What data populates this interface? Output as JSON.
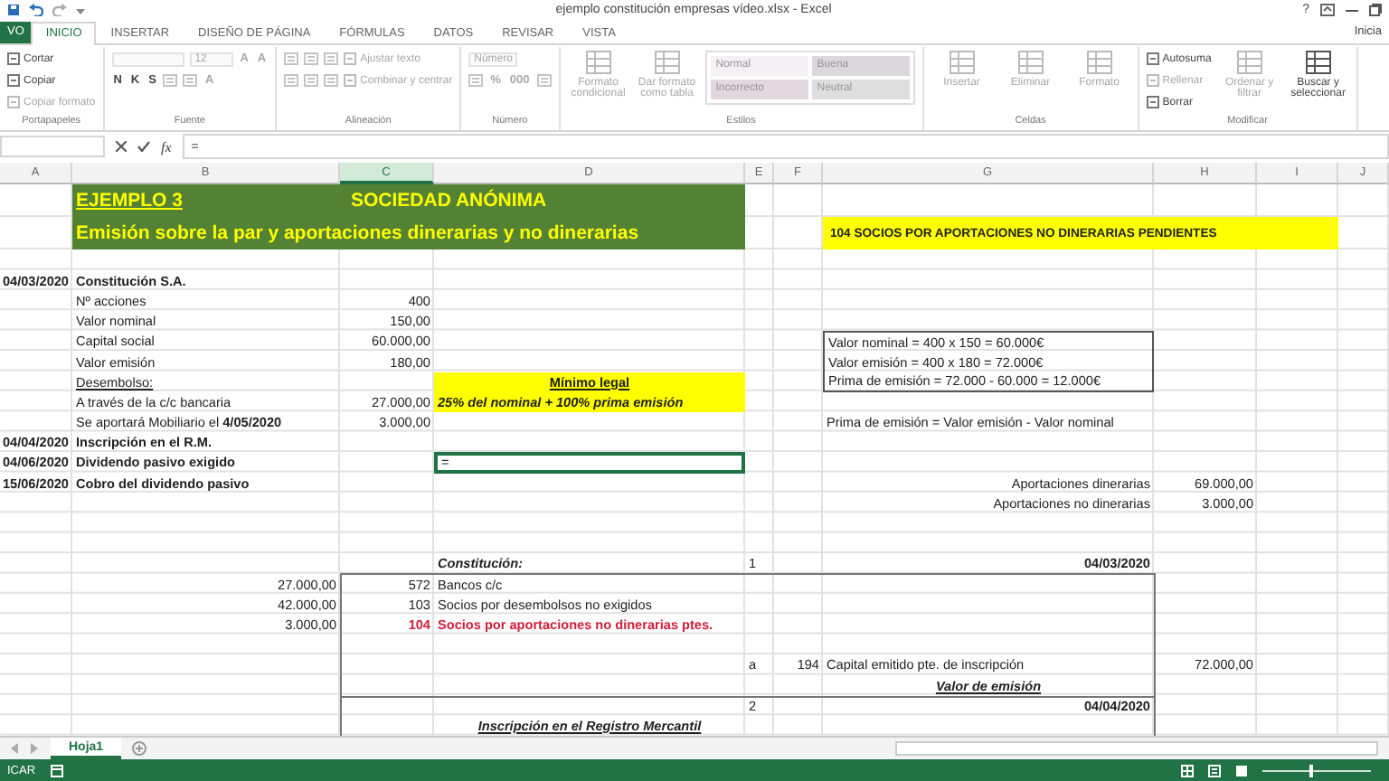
{
  "window": {
    "title": "ejemplo constitución empresas vídeo.xlsx - Excel",
    "help": "?",
    "account": "Inicia"
  },
  "tabs": [
    {
      "label": "VO",
      "kind": "file",
      "selected": false
    },
    {
      "label": "INICIO",
      "kind": "tab",
      "selected": true
    },
    {
      "label": "INSERTAR",
      "kind": "tab",
      "selected": false
    },
    {
      "label": "DISEÑO DE PÁGINA",
      "kind": "tab",
      "selected": false
    },
    {
      "label": "FÓRMULAS",
      "kind": "tab",
      "selected": false
    },
    {
      "label": "DATOS",
      "kind": "tab",
      "selected": false
    },
    {
      "label": "REVISAR",
      "kind": "tab",
      "selected": false
    },
    {
      "label": "VISTA",
      "kind": "tab",
      "selected": false
    }
  ],
  "ribbon": {
    "groups": [
      {
        "label": "Portapapeles",
        "items": [
          {
            "kind": "stack",
            "rows": [
              [
                {
                  "kind": "small",
                  "text": "Cortar",
                  "disabled": false
                }
              ],
              [
                {
                  "kind": "small",
                  "text": "Copiar",
                  "disabled": false
                }
              ],
              [
                {
                  "kind": "small",
                  "text": "Copiar formato",
                  "disabled": true
                }
              ]
            ]
          }
        ]
      },
      {
        "label": "Fuente",
        "items": [
          {
            "kind": "stack",
            "rows": [
              [
                {
                  "kind": "field",
                  "disabled": true
                },
                {
                  "kind": "field",
                  "value": "12",
                  "disabled": true
                },
                {
                  "kind": "glyph",
                  "text": "A",
                  "disabled": true
                },
                {
                  "kind": "glyph",
                  "text": "A",
                  "disabled": true
                }
              ],
              [
                {
                  "kind": "glyph",
                  "text": "N",
                  "disabled": false
                },
                {
                  "kind": "glyph",
                  "text": "K",
                  "disabled": false
                },
                {
                  "kind": "glyph",
                  "text": "S",
                  "disabled": false
                },
                {
                  "kind": "icon",
                  "disabled": true
                },
                {
                  "kind": "icon",
                  "disabled": true
                },
                {
                  "kind": "glyph",
                  "text": "A",
                  "disabled": true
                }
              ]
            ]
          }
        ]
      },
      {
        "label": "Alineación",
        "items": [
          {
            "kind": "stack",
            "rows": [
              [
                {
                  "kind": "icon",
                  "disabled": true
                },
                {
                  "kind": "icon",
                  "disabled": true
                },
                {
                  "kind": "icon",
                  "disabled": true
                },
                {
                  "kind": "small",
                  "text": "Ajustar texto",
                  "disabled": true
                }
              ],
              [
                {
                  "kind": "icon",
                  "disabled": true
                },
                {
                  "kind": "icon",
                  "disabled": true
                },
                {
                  "kind": "icon",
                  "disabled": true
                },
                {
                  "kind": "small",
                  "text": "Combinar y centrar",
                  "disabled": true
                }
              ]
            ]
          }
        ]
      },
      {
        "label": "Número",
        "items": [
          {
            "kind": "stack",
            "rows": [
              [
                {
                  "kind": "field",
                  "value": "Número",
                  "disabled": true
                }
              ],
              [
                {
                  "kind": "icon",
                  "disabled": true
                },
                {
                  "kind": "glyph",
                  "text": "%",
                  "disabled": true
                },
                {
                  "kind": "glyph",
                  "text": "000",
                  "disabled": true
                },
                {
                  "kind": "icon",
                  "disabled": true
                }
              ]
            ]
          }
        ]
      },
      {
        "label": "Estilos",
        "items": [
          {
            "kind": "big",
            "text": "Formato condicional",
            "disabled": true
          },
          {
            "kind": "big",
            "text": "Dar formato como tabla",
            "disabled": true
          },
          {
            "kind": "gallery",
            "cells": [
              {
                "text": "Normal",
                "color": "#f4f0f4"
              },
              {
                "text": "Buena",
                "color": "#dcd7dc"
              },
              {
                "text": "Incorrecto",
                "color": "#e2d7de"
              },
              {
                "text": "Neutral",
                "color": "#dedede"
              }
            ]
          }
        ]
      },
      {
        "label": "Celdas",
        "items": [
          {
            "kind": "big",
            "text": "Insertar",
            "disabled": true
          },
          {
            "kind": "big",
            "text": "Eliminar",
            "disabled": true
          },
          {
            "kind": "big",
            "text": "Formato",
            "disabled": true
          }
        ]
      },
      {
        "label": "Modificar",
        "items": [
          {
            "kind": "stack",
            "rows": [
              [
                {
                  "kind": "small",
                  "text": "Autosuma",
                  "disabled": false
                }
              ],
              [
                {
                  "kind": "small",
                  "text": "Rellenar",
                  "disabled": true
                }
              ],
              [
                {
                  "kind": "small",
                  "text": "Borrar",
                  "disabled": false
                }
              ]
            ]
          },
          {
            "kind": "big",
            "text": "Ordenar y filtrar",
            "disabled": true
          },
          {
            "kind": "big",
            "text": "Buscar y seleccionar",
            "disabled": false
          }
        ]
      }
    ]
  },
  "formula_bar": {
    "function_label": "fx",
    "content": "="
  },
  "sheet": {
    "columns": [
      {
        "label": "A",
        "selected": false
      },
      {
        "label": "B",
        "selected": false
      },
      {
        "label": "C",
        "selected": true
      },
      {
        "label": "D",
        "selected": false
      },
      {
        "label": "E",
        "selected": false
      },
      {
        "label": "F",
        "selected": false
      },
      {
        "label": "G",
        "selected": false
      },
      {
        "label": "H",
        "selected": false
      },
      {
        "label": "I",
        "selected": false
      },
      {
        "label": "J",
        "selected": false
      }
    ],
    "rows": [
      {
        "B": {
          "text": "EJEMPLO 3",
          "kind": "banner-label"
        },
        "C": {
          "text": "SOCIEDAD ANÓNIMA",
          "kind": "banner-title"
        }
      },
      {
        "B": {
          "text": "Emisión sobre la par y aportaciones dinerarias y no dinerarias",
          "kind": "banner-sub"
        },
        "G": {
          "text": "104 SOCIOS POR APORTACIONES NO DINERARIAS PENDIENTES",
          "kind": "note"
        }
      },
      {},
      {
        "A": {
          "text": "04/03/2020",
          "kind": "date"
        },
        "B": {
          "text": "Constitución S.A.",
          "kind": "heading"
        }
      },
      {
        "B": {
          "text": "Nº acciones",
          "kind": "text"
        },
        "C": {
          "text": "400",
          "kind": "number"
        }
      },
      {
        "B": {
          "text": "Valor nominal",
          "kind": "text"
        },
        "C": {
          "text": "150,00",
          "kind": "number"
        }
      },
      {
        "B": {
          "text": "Capital social",
          "kind": "text"
        },
        "C": {
          "text": "60.000,00",
          "kind": "number"
        },
        "G": {
          "text": "Valor nominal = 400 x 150 = 60.000€",
          "kind": "boxed"
        }
      },
      {
        "B": {
          "text": "Valor emisión",
          "kind": "text"
        },
        "C": {
          "text": "180,00",
          "kind": "number"
        },
        "G": {
          "text": "Valor emisión = 400 x 180 = 72.000€",
          "kind": "boxed"
        }
      },
      {
        "B": {
          "text": "Desembolso:",
          "kind": "underlined"
        },
        "D": {
          "text": "Mínimo legal",
          "kind": "legal-title"
        },
        "G": {
          "text": "Prima de emisión = 72.000 - 60.000 = 12.000€",
          "kind": "boxed"
        }
      },
      {
        "B": {
          "text": "A través  de la c/c bancaria",
          "kind": "text"
        },
        "C": {
          "text": "27.000,00",
          "kind": "number"
        },
        "D": {
          "text": "25% del nominal + 100% prima emisión",
          "kind": "legal-note"
        }
      },
      {
        "B": {
          "text": "Se aportará Mobiliario  el **4/05/2020**",
          "kind": "text"
        },
        "C": {
          "text": "3.000,00",
          "kind": "number"
        },
        "G": {
          "text": "Prima de emisión = Valor emisión - Valor nominal",
          "kind": "text"
        }
      },
      {
        "A": {
          "text": "04/04/2020",
          "kind": "date"
        },
        "B": {
          "text": "Inscripción en el R.M.",
          "kind": "heading"
        }
      },
      {
        "A": {
          "text": "04/06/2020",
          "kind": "date"
        },
        "B": {
          "text": "Dividendo pasivo exigido",
          "kind": "heading"
        },
        "D": {
          "text": "=",
          "kind": "active"
        }
      },
      {
        "A": {
          "text": "15/06/2020",
          "kind": "date"
        },
        "B": {
          "text": "Cobro del dividendo pasivo",
          "kind": "heading"
        },
        "G": {
          "text": "Aportaciones dinerarias",
          "kind": "label-right"
        },
        "H": {
          "text": "69.000,00",
          "kind": "number"
        }
      },
      {
        "G": {
          "text": "Aportaciones no dinerarias",
          "kind": "label-right"
        },
        "H": {
          "text": "3.000,00",
          "kind": "number"
        }
      },
      {},
      {},
      {
        "D": {
          "text": "Constitución:",
          "kind": "entry-title"
        },
        "E": {
          "text": "1",
          "kind": "text"
        },
        "G": {
          "text": "04/03/2020",
          "kind": "entry-date"
        }
      },
      {
        "B": {
          "text": "27.000,00",
          "kind": "number"
        },
        "C": {
          "text": "572",
          "kind": "number"
        },
        "D": {
          "text": "Bancos c/c",
          "kind": "text"
        }
      },
      {
        "B": {
          "text": "42.000,00",
          "kind": "number"
        },
        "C": {
          "text": "103",
          "kind": "number"
        },
        "D": {
          "text": "Socios por desembolsos no exigidos",
          "kind": "text"
        }
      },
      {
        "B": {
          "text": "3.000,00",
          "kind": "number"
        },
        "C": {
          "text": "104",
          "kind": "account-red"
        },
        "D": {
          "text": "Socios por aportaciones no dinerarias ptes.",
          "kind": "red"
        }
      },
      {},
      {
        "E": {
          "text": "a",
          "kind": "text"
        },
        "F": {
          "text": "194",
          "kind": "number"
        },
        "G": {
          "text": "Capital emitido pte. de inscripción",
          "kind": "text"
        },
        "H": {
          "text": "72.000,00",
          "kind": "number"
        }
      },
      {
        "G": {
          "text": "Valor de emisión",
          "kind": "caption"
        }
      },
      {
        "E": {
          "text": "2",
          "kind": "text"
        },
        "G": {
          "text": "04/04/2020",
          "kind": "entry-date"
        }
      },
      {
        "D": {
          "text": "Inscripción en el Registro Mercantil",
          "kind": "caption"
        }
      }
    ]
  },
  "sheet_tabs": [
    {
      "label": "Hoja1",
      "selected": true
    }
  ],
  "status_bar": {
    "text": "ICAR",
    "zoom": {
      "level": 0.45
    }
  }
}
